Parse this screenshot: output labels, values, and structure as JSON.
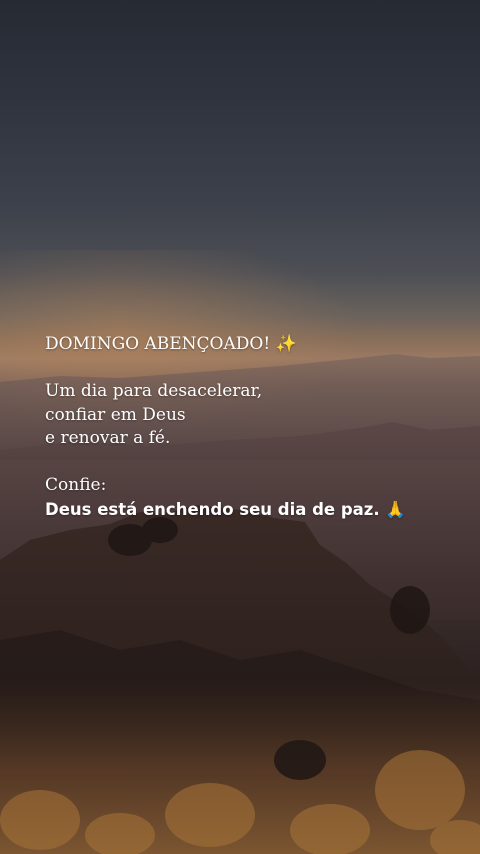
{
  "caption": {
    "title": "DOMINGO ABENÇOADO! ✨",
    "body_lines": [
      "Um dia para desacelerar,",
      "confiar em Deus",
      "e renovar a fé."
    ],
    "closing_label": "Confie:",
    "closing_message": "Deus está enchendo seu dia de paz. 🙏"
  },
  "colors": {
    "sky_top": "#262a33",
    "horizon_glow": "#9b7a63",
    "mountain_shadow": "#2a1f1e",
    "autumn_foliage": "#8a5a2e",
    "text": "#ffffff"
  }
}
